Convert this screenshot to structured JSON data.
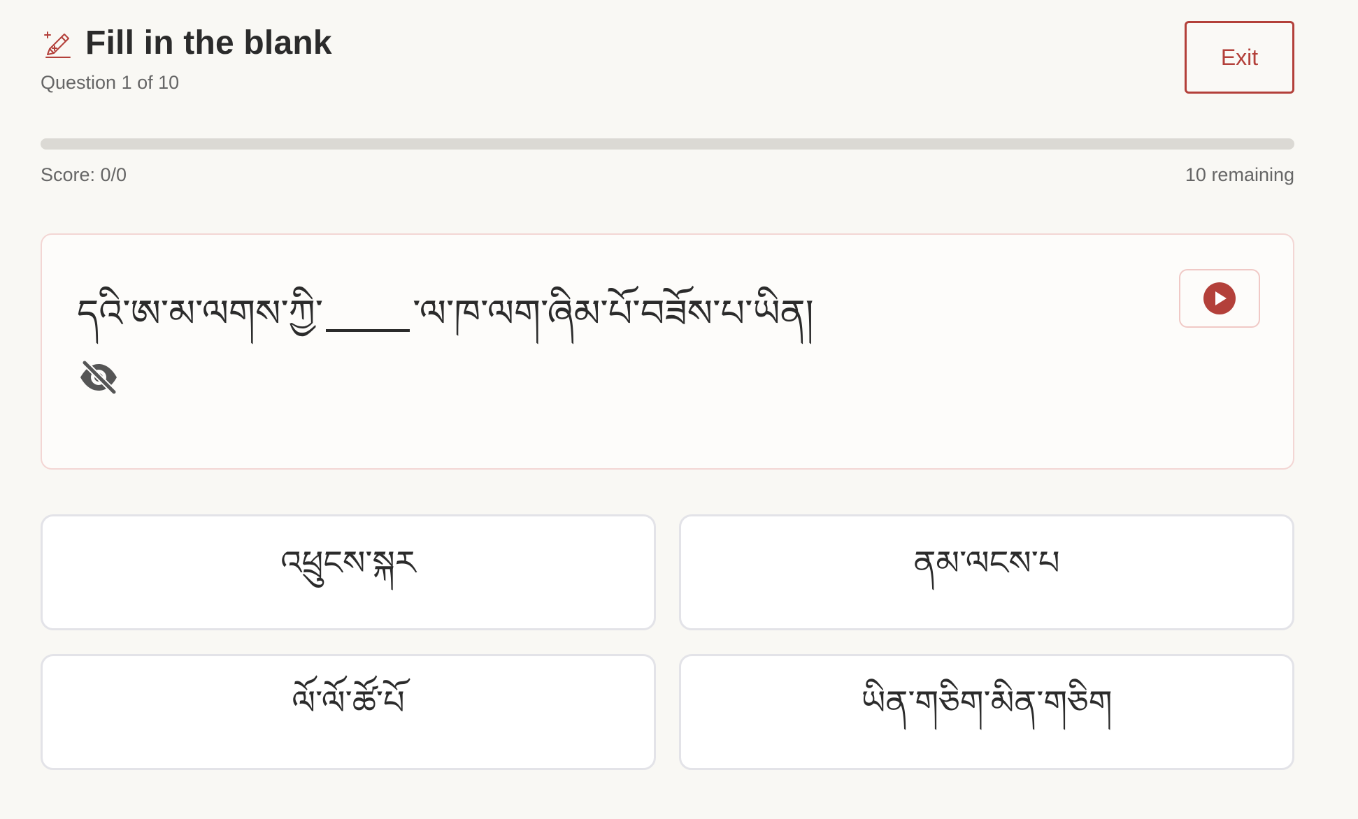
{
  "header": {
    "icon": "pencil-sparkle-icon",
    "title": "Fill in the blank",
    "subtitle": "Question 1 of 10"
  },
  "exit_label": "Exit",
  "progress": {
    "completed": 0,
    "total": 10
  },
  "score_text": "Score: 0/0",
  "remaining_text": "10 remaining",
  "question": {
    "before_blank": "དའི་ཨ་མ་ལགས་ཀྱི་",
    "after_blank": "་ལ་ཁ་ལག་ཞིམ་པོ་བཟོས་པ་ཡིན།",
    "audio_icon": "play-circle-icon",
    "visibility_icon": "eye-off-icon"
  },
  "options": [
    {
      "label": "འཕྲུངས་སྐར"
    },
    {
      "label": "ནམ་ལངས་པ"
    },
    {
      "label": "ལོ་ལོ་ཚོ་པོ"
    },
    {
      "label": "ཡིན་གཅིག་མིན་གཅིག"
    }
  ],
  "colors": {
    "accent": "#b3403a",
    "background": "#f9f8f4",
    "card_border": "#f3d6d4",
    "option_border": "#e3e3e8"
  }
}
